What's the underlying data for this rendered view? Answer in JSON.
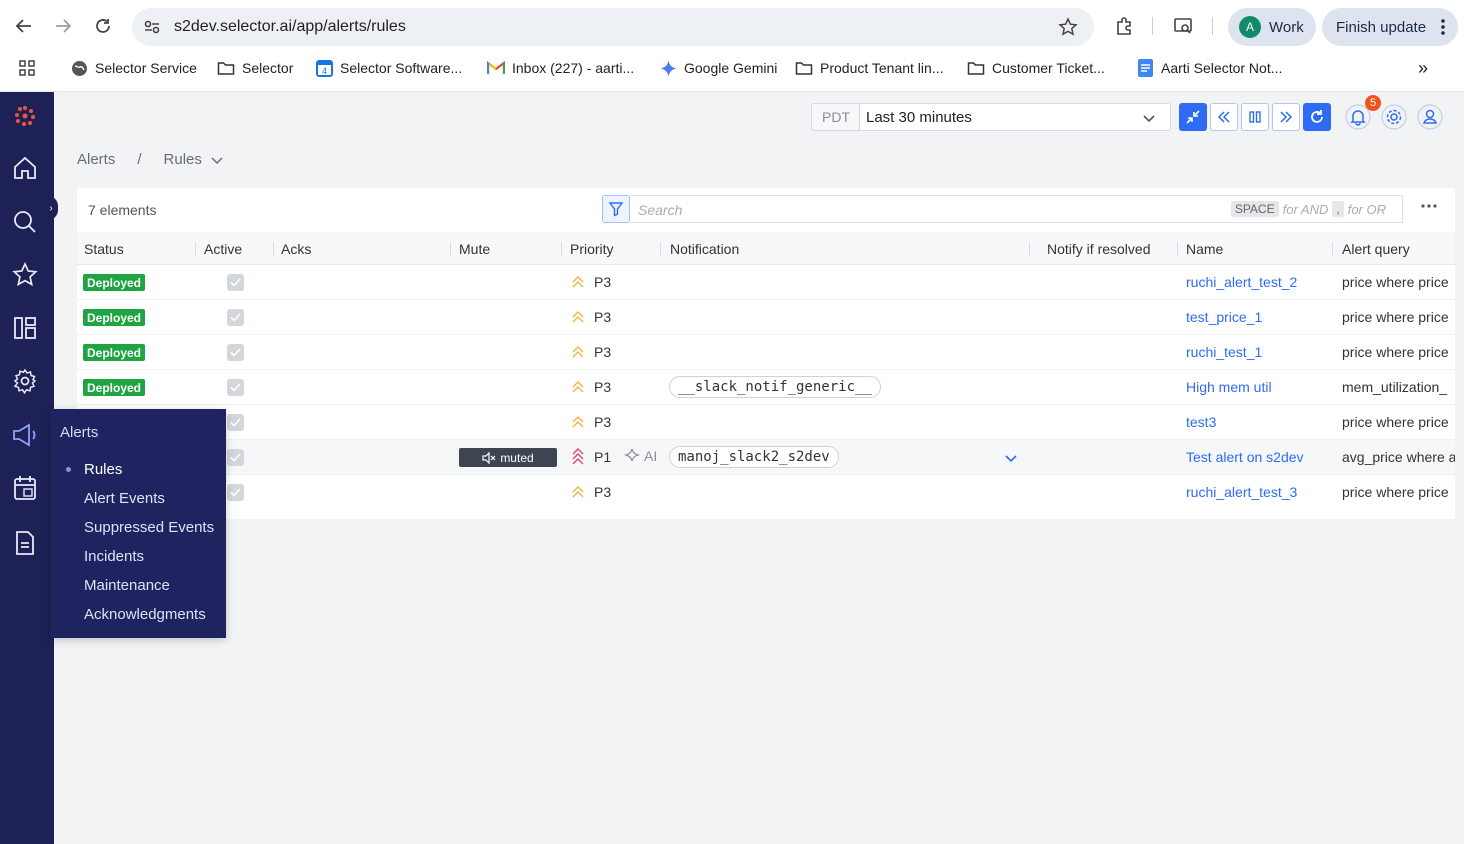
{
  "browser": {
    "url": "s2dev.selector.ai/app/alerts/rules",
    "profile": {
      "initial": "A",
      "label": "Work"
    },
    "finish_update_label": "Finish update",
    "bookmarks": [
      {
        "label": "Selector Service"
      },
      {
        "label": "Selector"
      },
      {
        "label": "Selector Software..."
      },
      {
        "label": "Inbox (227) - aarti..."
      },
      {
        "label": "Google Gemini"
      },
      {
        "label": "Product Tenant lin..."
      },
      {
        "label": "Customer Ticket..."
      },
      {
        "label": "Aarti Selector Not..."
      }
    ],
    "overflow_label": "»"
  },
  "toolbar": {
    "timezone": "PDT",
    "time_range": "Last 30 minutes",
    "notification_count": "5"
  },
  "breadcrumb": {
    "root": "Alerts",
    "separator": "/",
    "current": "Rules"
  },
  "flyout": {
    "title": "Alerts",
    "items": [
      {
        "label": "Rules"
      },
      {
        "label": "Alert Events"
      },
      {
        "label": "Suppressed Events"
      },
      {
        "label": "Incidents"
      },
      {
        "label": "Maintenance"
      },
      {
        "label": "Acknowledgments"
      }
    ]
  },
  "table": {
    "count_label": "7 elements",
    "search_placeholder": "Search",
    "hint": {
      "key1": "SPACE",
      "text1": "for AND",
      "key2": ",",
      "text2": "for OR"
    },
    "columns": {
      "status": "Status",
      "active": "Active",
      "acks": "Acks",
      "mute": "Mute",
      "priority": "Priority",
      "notification": "Notification",
      "notify_resolved": "Notify if resolved",
      "name": "Name",
      "query": "Alert query"
    },
    "muted_label": "muted",
    "ai_label": "AI",
    "rows": [
      {
        "status": "Deployed",
        "priority": "P3",
        "notification": "",
        "name": "ruchi_alert_test_2",
        "query": "price where price"
      },
      {
        "status": "Deployed",
        "priority": "P3",
        "notification": "",
        "name": "test_price_1",
        "query": "price where price"
      },
      {
        "status": "Deployed",
        "priority": "P3",
        "notification": "",
        "name": "ruchi_test_1",
        "query": "price where price"
      },
      {
        "status": "Deployed",
        "priority": "P3",
        "notification": "__slack_notif_generic__",
        "name": "High mem util",
        "query": "mem_utilization_"
      },
      {
        "status": "",
        "priority": "P3",
        "notification": "",
        "name": "test3",
        "query": "price where price"
      },
      {
        "status": "",
        "priority": "P1",
        "notification": "manoj_slack2_s2dev",
        "name": "Test alert on s2dev",
        "query": "avg_price where a"
      },
      {
        "status": "",
        "priority": "P3",
        "notification": "",
        "name": "ruchi_alert_test_3",
        "query": "price where price"
      }
    ]
  },
  "colors": {
    "sidebar": "#1d2155",
    "accent": "#2d6cf2",
    "deployed": "#1fa442",
    "p3": "#f2b441",
    "p1": "#e0436b"
  }
}
